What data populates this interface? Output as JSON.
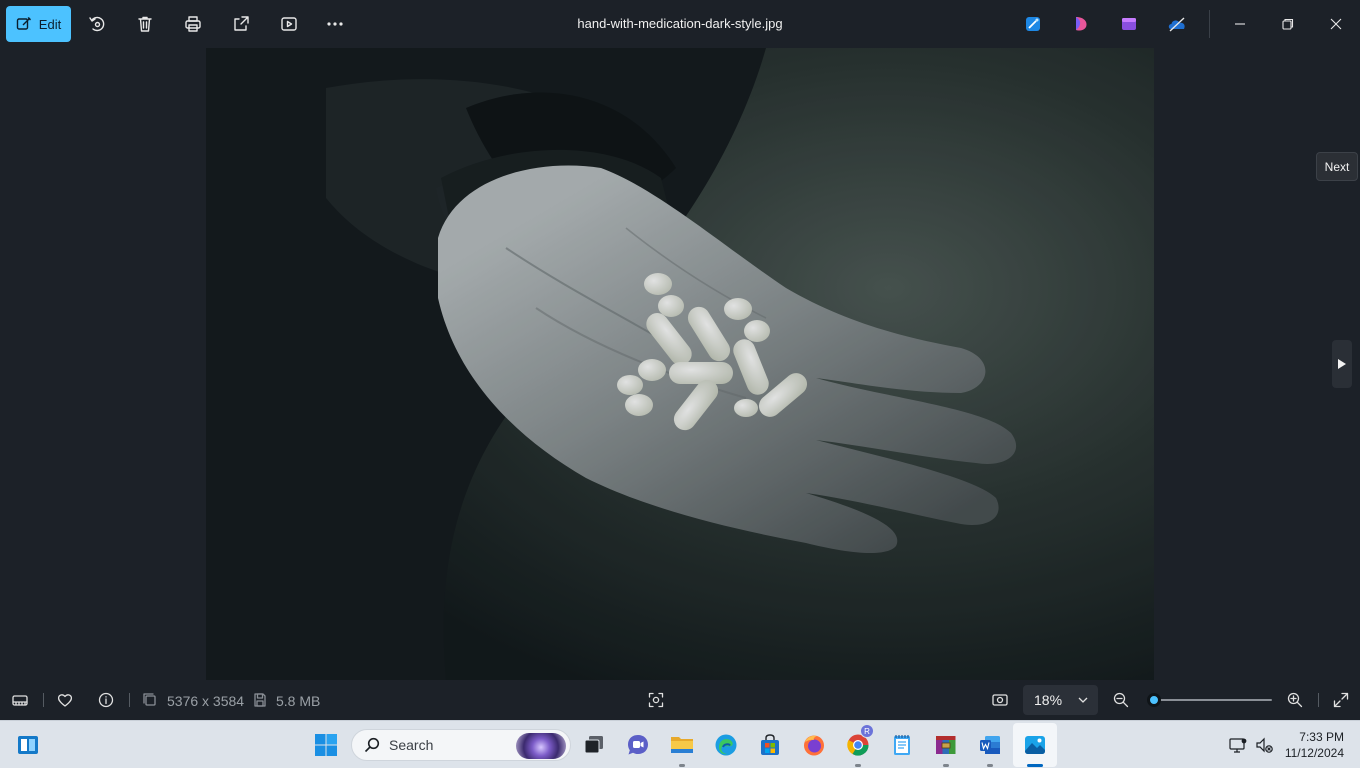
{
  "toolbar": {
    "edit_label": "Edit",
    "icons": [
      "rotate-icon",
      "delete-icon",
      "print-icon",
      "share-icon",
      "slideshow-icon",
      "more-options-icon"
    ],
    "file_title": "hand-with-medication-dark-style.jpg"
  },
  "app_icons": [
    "designer-icon",
    "clipchamp-spark-icon",
    "clipchamp-icon",
    "onedrive-icon"
  ],
  "window_controls": [
    "minimize",
    "restore",
    "close"
  ],
  "photo": {
    "subject": "open hand holding white pills and capsules against a dark background"
  },
  "navigation": {
    "next_tooltip": "Next"
  },
  "status_bar": {
    "dimensions": "5376 x 3584",
    "file_size": "5.8 MB",
    "zoom": "18%",
    "zoom_level": 0.0
  },
  "taskbar": {
    "search_placeholder": "Search",
    "apps": [
      "widgets",
      "start",
      "search",
      "task-view",
      "teams-chat",
      "file-explorer",
      "edge",
      "microsoft-store",
      "firefox",
      "chrome",
      "notepad",
      "winrar",
      "word",
      "photos"
    ],
    "chrome_badge": "R",
    "time": "7:33 PM",
    "date": "11/12/2024"
  },
  "colors": {
    "accent": "#4cc2ff",
    "background": "#1c2128",
    "taskbar": "#dde3ea"
  }
}
